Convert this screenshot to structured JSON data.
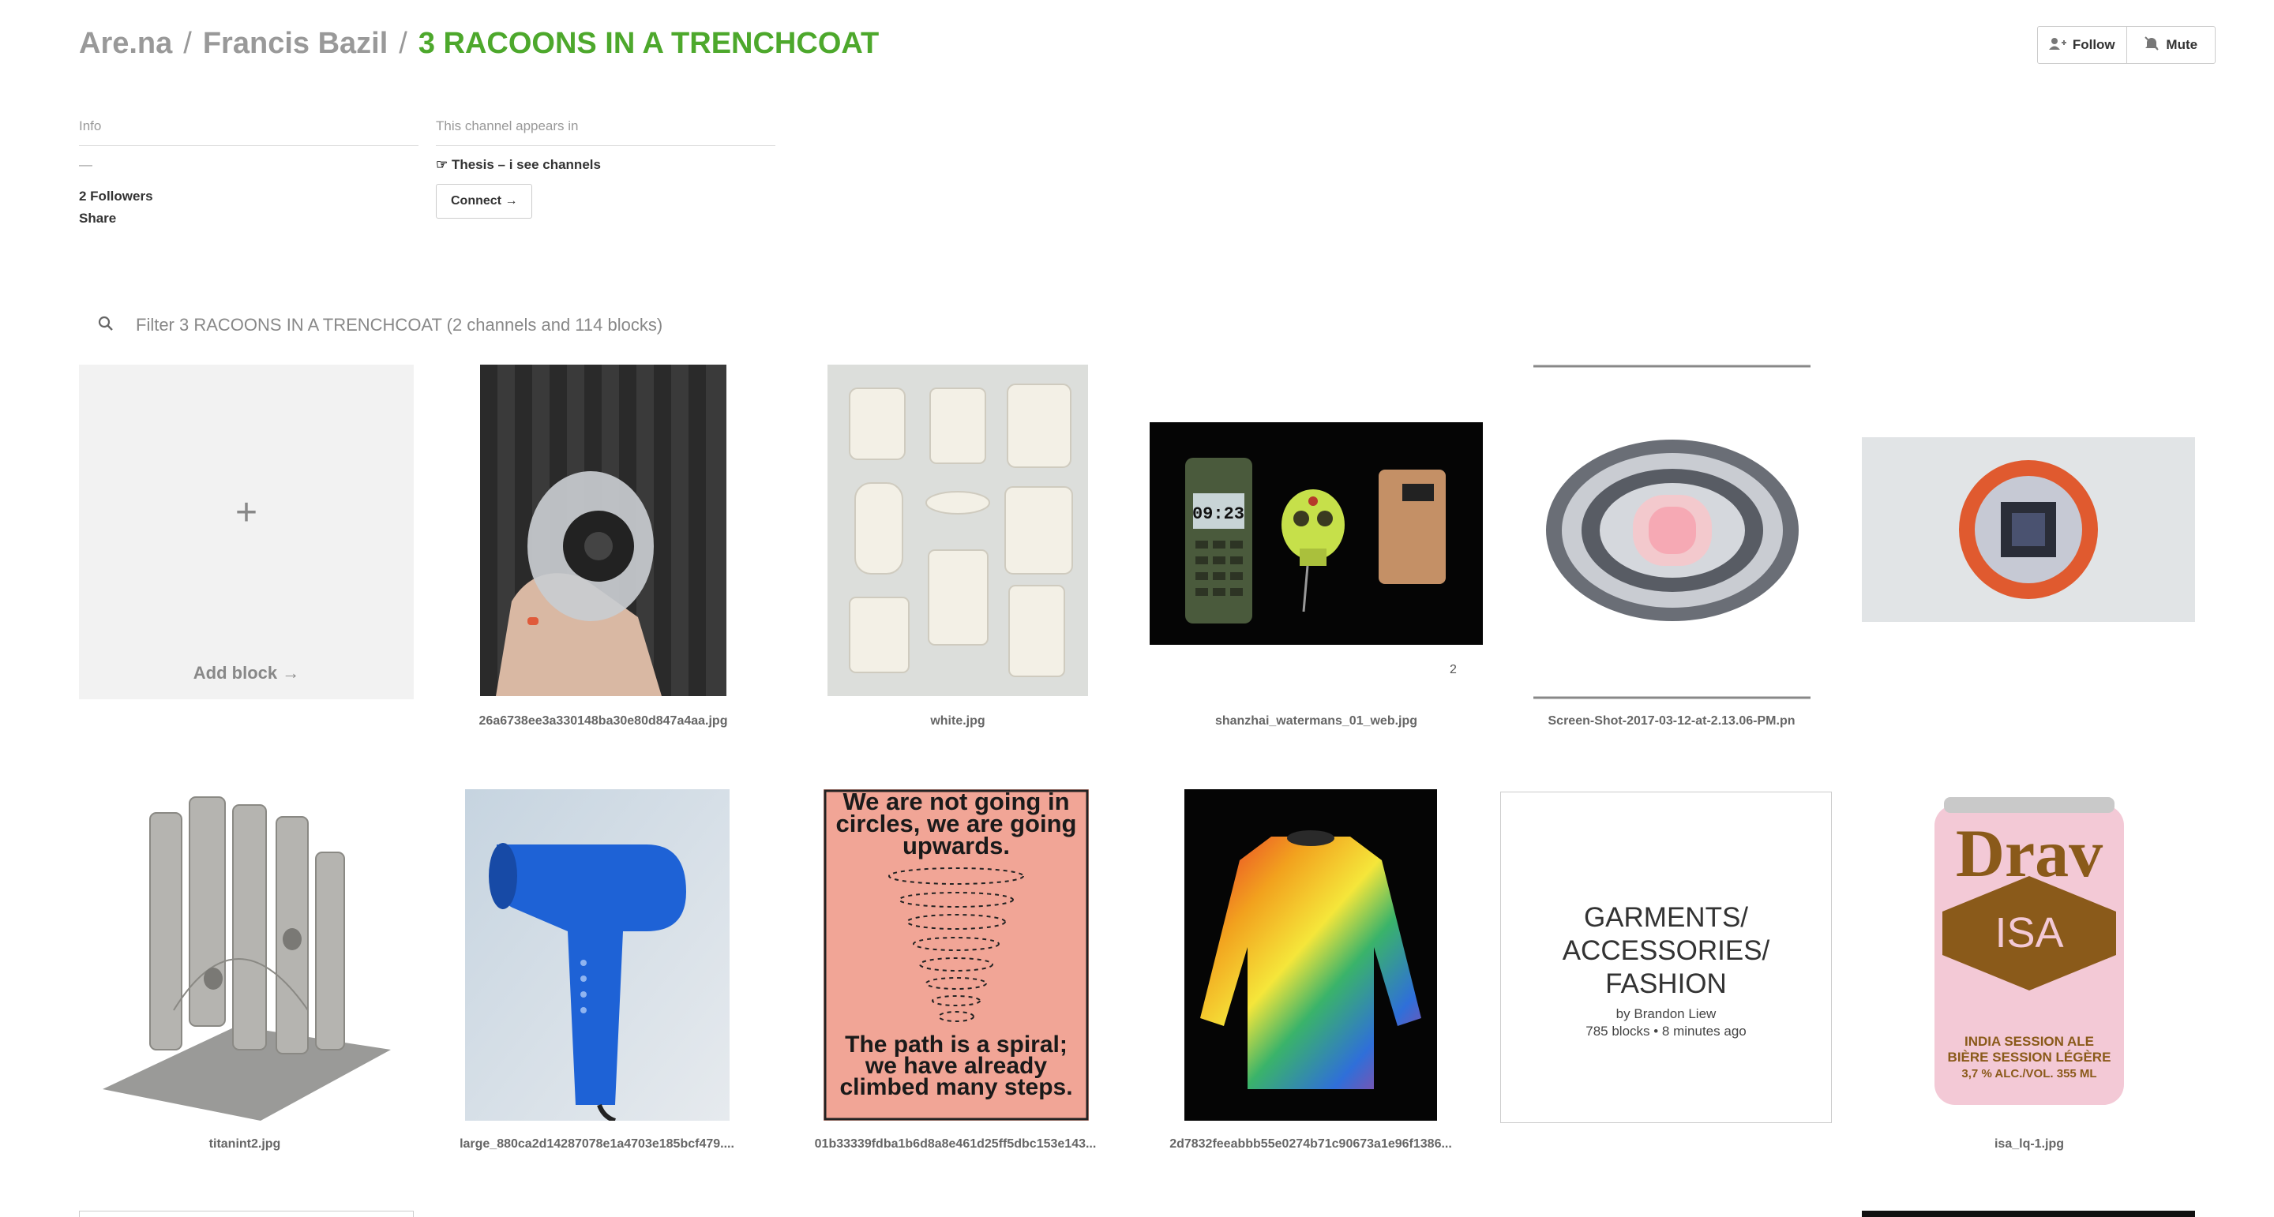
{
  "breadcrumb": {
    "root": "Are.na",
    "user": "Francis Bazil",
    "channel": "3 RACOONS IN A TRENCHCOAT",
    "separator": "/"
  },
  "header_buttons": {
    "follow": "Follow",
    "mute": "Mute"
  },
  "info": {
    "heading": "Info",
    "description": "—",
    "followers": "2 Followers",
    "share": "Share"
  },
  "appears_in": {
    "heading": "This channel appears in",
    "channel": "☞ Thesis – i see channels",
    "connect": "Connect →"
  },
  "filter": {
    "placeholder": "Filter 3 RACOONS IN A TRENCHCOAT (2 channels and 114 blocks)"
  },
  "add_block": {
    "plus": "+",
    "label": "Add block →"
  },
  "blocks": [
    {
      "caption": "26a6738ee3a330148ba30e80d847a4aa.jpg"
    },
    {
      "caption": "white.jpg"
    },
    {
      "caption": "shanzhai_watermans_01_web.jpg",
      "count": "2"
    },
    {
      "caption": "Screen-Shot-2017-03-12-at-2.13.06-PM.pn"
    },
    {
      "caption": ""
    },
    {
      "caption": "titanint2.jpg"
    },
    {
      "caption": "large_880ca2d14287078e1a4703e185bcf479...."
    },
    {
      "caption": "01b33339fdba1b6d8a8e461d25ff5dbc153e143..."
    },
    {
      "caption": "2d7832feeabbb55e0274b71c90673a1e96f1386..."
    },
    {
      "caption": "isa_lq-1.jpg"
    }
  ],
  "phone": {
    "time": "09:23"
  },
  "poster": {
    "top": "We are not going in circles, we are going upwards.",
    "bottom": "The path is a spiral; we have already climbed many steps."
  },
  "can": {
    "brand": "Drav",
    "label": "ISA",
    "sub1": "INDIA SESSION ALE",
    "sub2": "BIÈRE SESSION LÉGÈRE",
    "sub3": "3,7 % ALC./VOL. 355 ML"
  },
  "text_block": {
    "title_lines": [
      "GARMENTS/",
      "ACCESSORIES/",
      "FASHION"
    ],
    "author": "by Brandon Liew",
    "meta": "785 blocks • 8 minutes ago"
  },
  "colors": {
    "channel_green": "#4da82c",
    "muted": "#999999"
  }
}
